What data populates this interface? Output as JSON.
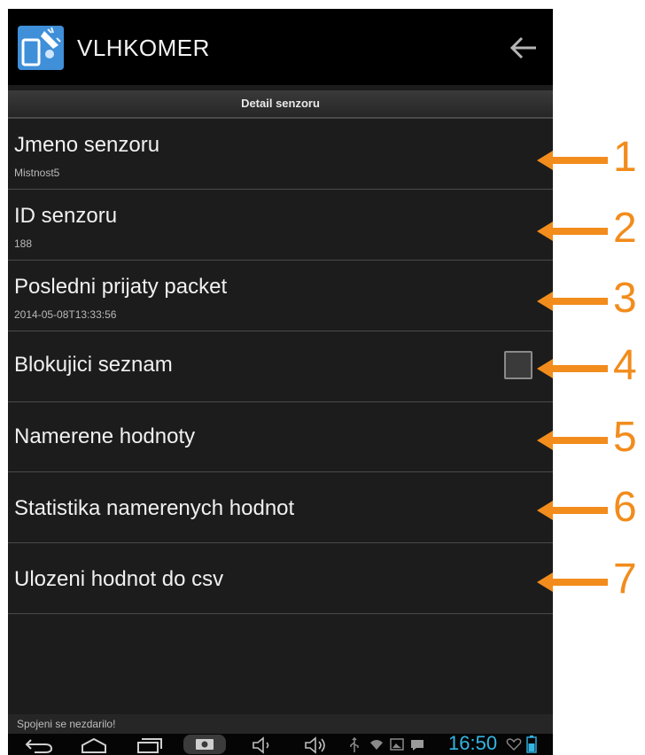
{
  "app": {
    "title": "VLHKOMER"
  },
  "section_header": "Detail senzoru",
  "rows": [
    {
      "title": "Jmeno senzoru",
      "subtitle": "Mistnost5"
    },
    {
      "title": "ID senzoru",
      "subtitle": "188"
    },
    {
      "title": "Posledni prijaty packet",
      "subtitle": "2014-05-08T13:33:56"
    },
    {
      "title": "Blokujici seznam",
      "checked": false
    },
    {
      "title": "Namerene hodnoty"
    },
    {
      "title": "Statistika namerenych hodnot"
    },
    {
      "title": "Ulozeni hodnot do csv"
    }
  ],
  "status_message": "Spojeni se nezdarilo!",
  "clock": "16:50",
  "annotations": [
    "1",
    "2",
    "3",
    "4",
    "5",
    "6",
    "7"
  ],
  "icons": {
    "app": "app-logo-icon",
    "back": "back-arrow-icon",
    "nav_back": "nav-back-icon",
    "nav_home": "nav-home-icon",
    "nav_recent": "nav-recent-apps-icon",
    "screenshot": "screenshot-icon",
    "vol_down": "volume-down-icon",
    "vol_up": "volume-up-icon"
  },
  "colors": {
    "accent": "#33b5e5",
    "annotation": "#f28c1c",
    "app_icon": "#3f8fd9"
  }
}
